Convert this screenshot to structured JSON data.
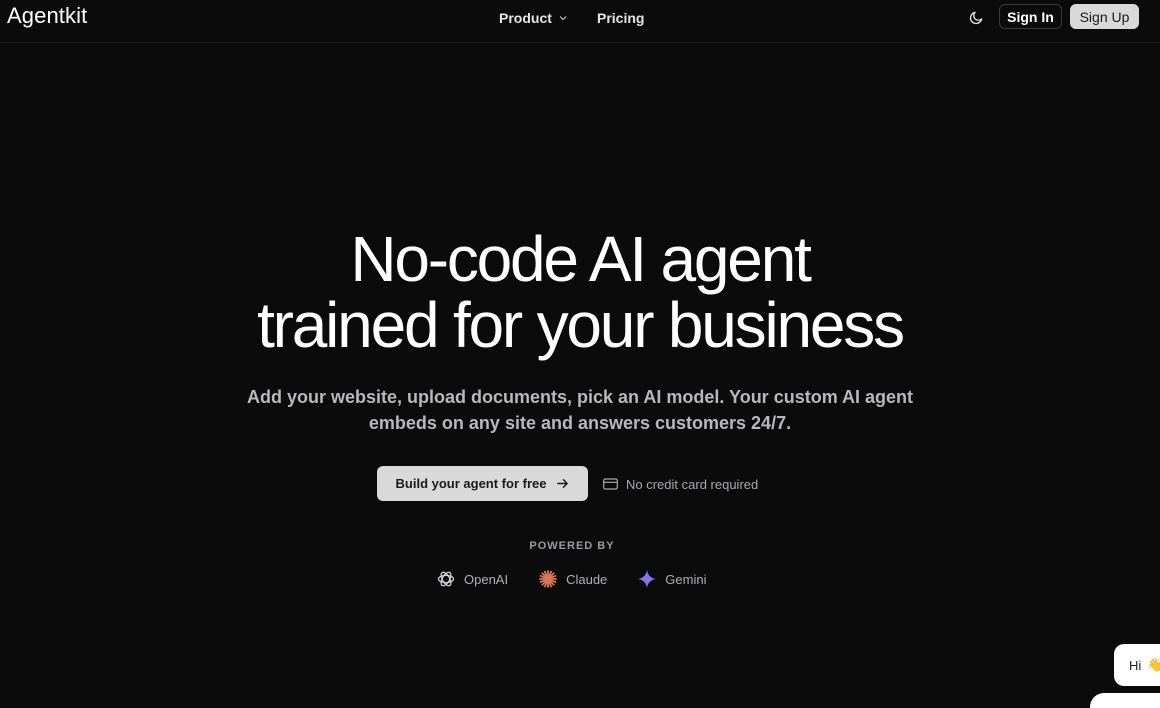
{
  "header": {
    "logo": "Agentkit",
    "nav": [
      {
        "label": "Product"
      },
      {
        "label": "Pricing"
      }
    ],
    "sign_in": "Sign In",
    "sign_up": "Sign Up"
  },
  "hero": {
    "title_line1": "No-code AI agent",
    "title_line2": "trained for your business",
    "subtitle": "Add your website, upload documents, pick an AI model. Your custom AI agent embeds on any site and answers customers 24/7.",
    "cta_label": "Build your agent for free",
    "no_cc": "No credit card required"
  },
  "powered_by": {
    "label": "POWERED BY",
    "providers": [
      {
        "name": "OpenAI",
        "icon": "openai-icon"
      },
      {
        "name": "Claude",
        "icon": "claude-icon",
        "color": "#d97757"
      },
      {
        "name": "Gemini",
        "icon": "gemini-icon",
        "color": "#8a6cf0"
      }
    ]
  },
  "chat": {
    "greeting": "Hi",
    "emoji": "👋"
  },
  "colors": {
    "background": "#0b0b0c",
    "button_light": "#d9d9d9",
    "text_primary": "#ffffff",
    "text_muted": "#b8b8bc"
  }
}
